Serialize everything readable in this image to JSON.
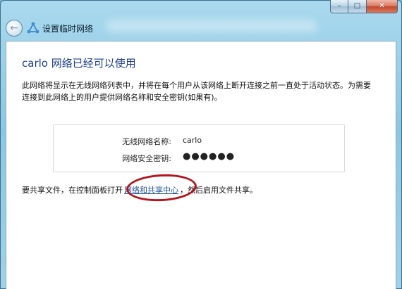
{
  "window": {
    "title": "设置临时网络",
    "caption": {
      "minimize": "–",
      "maximize": "□",
      "close": "✕"
    }
  },
  "nav": {
    "back_icon": "←"
  },
  "content": {
    "heading": "carlo 网络已经可以使用",
    "description": "此网络将显示在无线网络列表中，并将在每个用户从该网络上断开连接之前一直处于活动状态。为需要连接到此网络上的用户提供网络名称和安全密钥(如果有)。",
    "network_name_label": "无线网络名称:",
    "network_name_value": "carlo",
    "security_key_label": "网络安全密钥:",
    "security_key_value": "●●●●●●",
    "share_prefix": "要共享文件，在控制面板打开",
    "share_link": "网络和共享中心",
    "share_suffix": "，然后启用文件共享。"
  },
  "colors": {
    "heading": "#1e3f8c",
    "link": "#1a4f9c",
    "highlight": "#b5161d"
  }
}
